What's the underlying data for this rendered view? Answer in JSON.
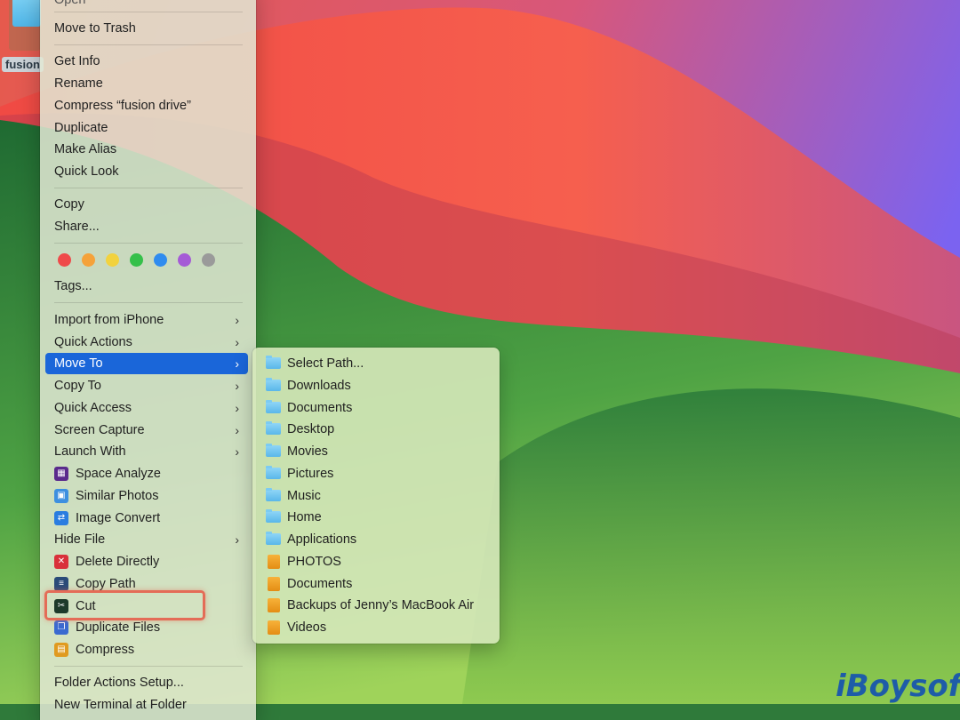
{
  "desktop": {
    "icon_label": "fusion"
  },
  "menu": {
    "top_partial": "Open",
    "items_a": [
      "Move to Trash"
    ],
    "items_b": [
      "Get Info",
      "Rename",
      "Compress “fusion drive”",
      "Duplicate",
      "Make Alias",
      "Quick Look"
    ],
    "items_c": [
      "Copy",
      "Share..."
    ],
    "tag_colors": [
      "#ef4a4a",
      "#f5a23a",
      "#f2d23e",
      "#35c04a",
      "#2f8cef",
      "#a55bd6",
      "#9a9a9a"
    ],
    "tags_label": "Tags...",
    "submenu_items": [
      {
        "label": "Import from iPhone"
      },
      {
        "label": "Quick Actions"
      },
      {
        "label": "Move To"
      },
      {
        "label": "Copy To"
      },
      {
        "label": "Quick Access"
      },
      {
        "label": "Screen Capture"
      },
      {
        "label": "Launch With"
      }
    ],
    "app_items": [
      {
        "label": "Space Analyze",
        "icon": "space-analyze-icon",
        "color": "#5a2a8c"
      },
      {
        "label": "Similar Photos",
        "icon": "similar-photos-icon",
        "color": "#3d8fe0"
      },
      {
        "label": "Image Convert",
        "icon": "image-convert-icon",
        "color": "#2a7de0"
      }
    ],
    "hide_file": "Hide File",
    "app_items_2": [
      {
        "label": "Delete Directly",
        "icon": "delete-icon",
        "color": "#d9303a"
      },
      {
        "label": "Copy Path",
        "icon": "copy-path-icon",
        "color": "#2a4a78"
      },
      {
        "label": "Cut",
        "icon": "scissors-icon",
        "color": "#1e3a2a"
      },
      {
        "label": "Duplicate Files",
        "icon": "duplicate-files-icon",
        "color": "#3a6ad0"
      },
      {
        "label": "Compress",
        "icon": "compress-icon",
        "color": "#e09a20"
      }
    ],
    "bottom": [
      "Folder Actions Setup...",
      "New Terminal at Folder"
    ]
  },
  "move_to": {
    "items": [
      {
        "label": "Select Path...",
        "kind": "blue"
      },
      {
        "label": "Downloads",
        "kind": "blue"
      },
      {
        "label": "Documents",
        "kind": "blue"
      },
      {
        "label": "Desktop",
        "kind": "blue"
      },
      {
        "label": "Movies",
        "kind": "blue"
      },
      {
        "label": "Pictures",
        "kind": "blue"
      },
      {
        "label": "Music",
        "kind": "blue"
      },
      {
        "label": "Home",
        "kind": "blue"
      },
      {
        "label": "Applications",
        "kind": "blue"
      },
      {
        "label": "PHOTOS",
        "kind": "orange"
      },
      {
        "label": "Documents",
        "kind": "orange"
      },
      {
        "label": "Backups of Jenny’s MacBook Air",
        "kind": "orange"
      },
      {
        "label": "Videos",
        "kind": "orange"
      }
    ]
  },
  "watermark": "iBoysoft"
}
